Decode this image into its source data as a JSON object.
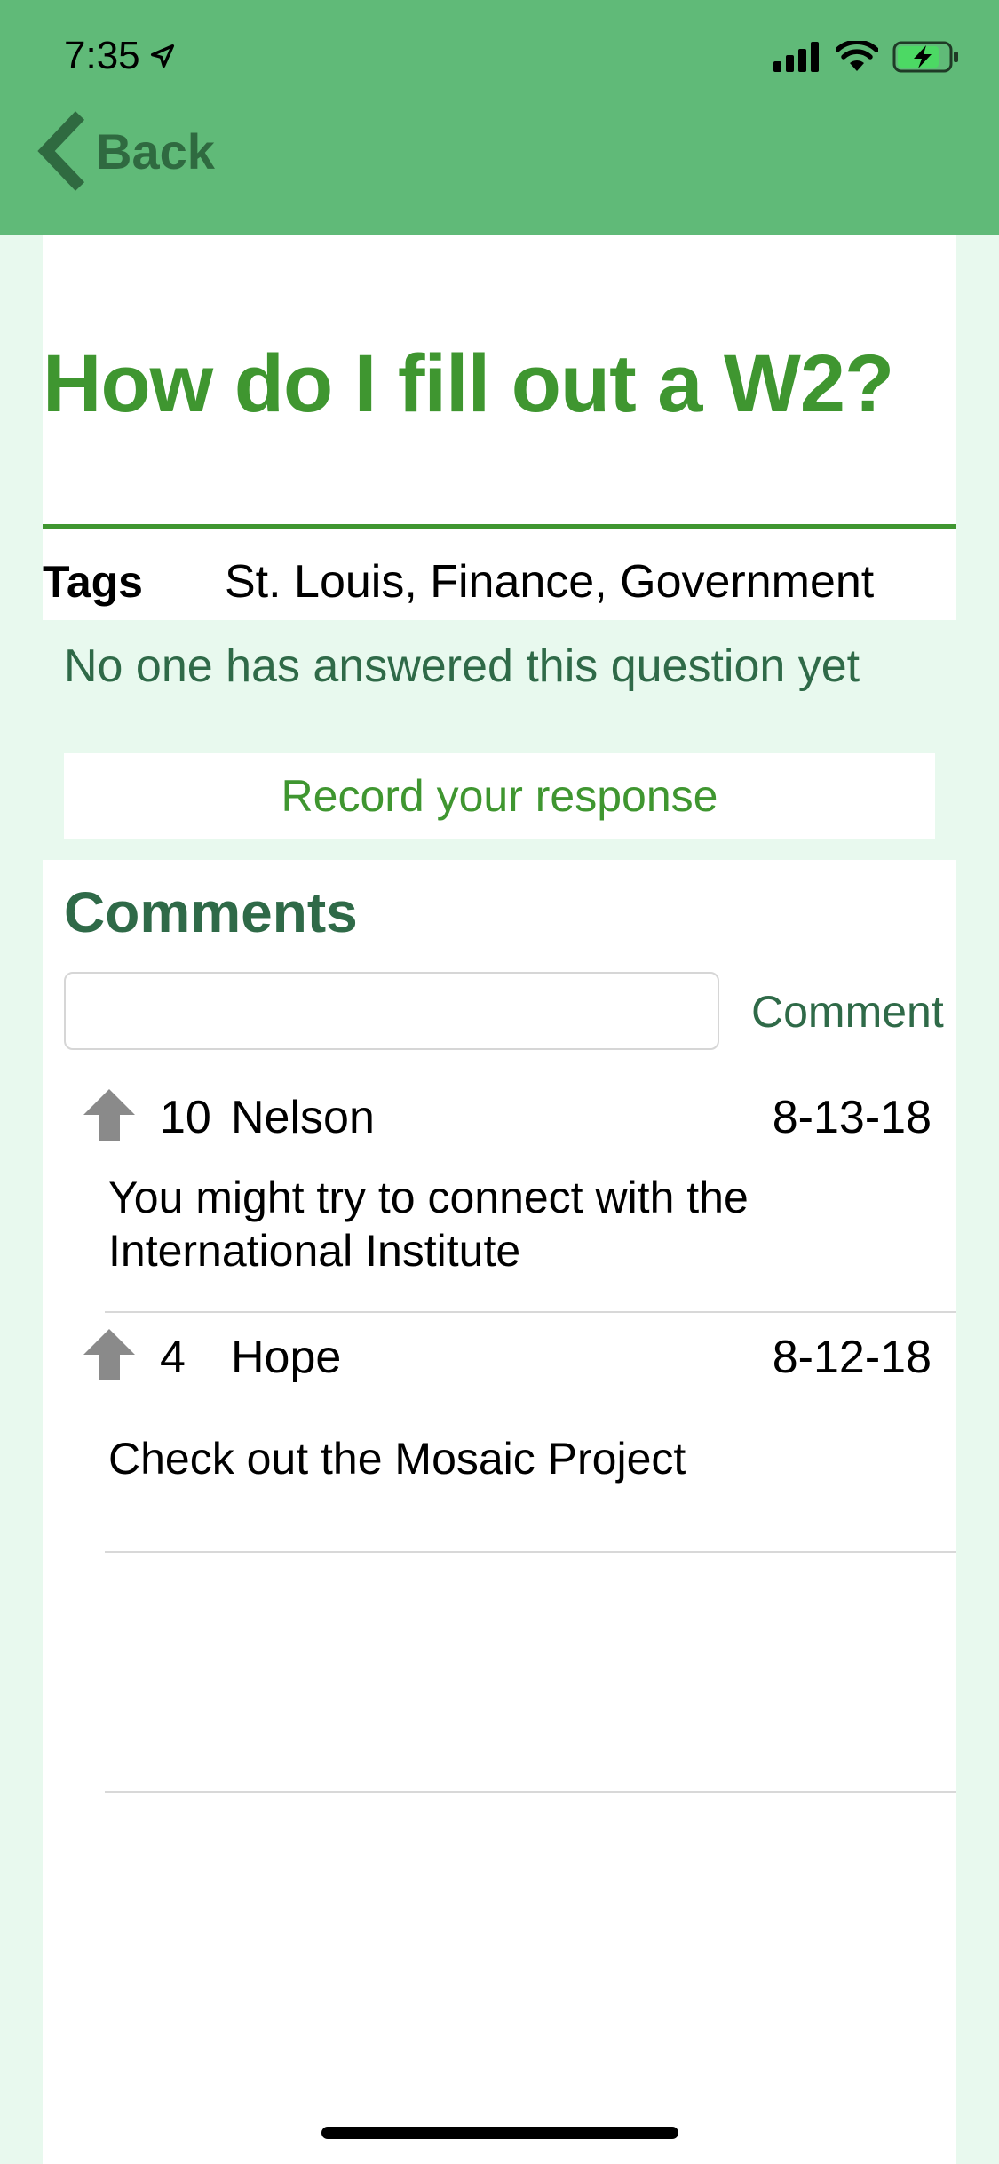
{
  "status_bar": {
    "time": "7:35"
  },
  "nav": {
    "back_label": "Back"
  },
  "question": {
    "title": "How do I fill out a W2?",
    "tags_label": "Tags",
    "tags_value": "St. Louis, Finance, Government"
  },
  "answer": {
    "no_answer_text": "No one has answered this question yet",
    "record_button": "Record your response"
  },
  "comments": {
    "heading": "Comments",
    "input_value": "",
    "submit_label": "Comment",
    "items": [
      {
        "votes": "10",
        "author": "Nelson",
        "date": "8-13-18",
        "body": "You might try to connect with the International Institute"
      },
      {
        "votes": "4",
        "author": "Hope",
        "date": "8-12-18",
        "body": "Check out the Mosaic Project"
      }
    ]
  },
  "colors": {
    "header": "#60ba78",
    "accent": "#3f9630",
    "dark_green": "#2f6a48",
    "light_background": "#e8f9ee"
  },
  "icons": [
    "location-arrow-icon",
    "cellular-signal-icon",
    "wifi-icon",
    "battery-charging-icon",
    "chevron-left-icon",
    "upvote-arrow-icon"
  ]
}
